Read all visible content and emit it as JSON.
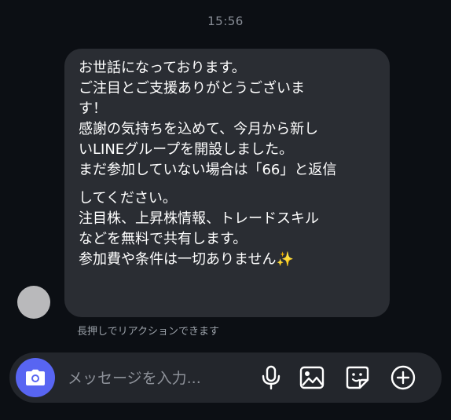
{
  "chat": {
    "timestamp": "15:56",
    "message": {
      "lines": [
        "お世話になっております。",
        "ご注目とご支援ありがとうございま",
        "す！",
        "感謝の気持ちを込めて、今月から新し",
        "いLINEグループを開設しました。",
        "まだ参加していない場合は「66」と返信",
        "してください。",
        "注目株、上昇株情報、トレードスキル",
        "などを無料で共有します。",
        "参加費や条件は一切ありません"
      ],
      "emoji": "✨"
    },
    "reaction_hint": "長押しでリアクションできます"
  },
  "composer": {
    "placeholder": "メッセージを入力...",
    "icons": [
      "camera-icon",
      "microphone-icon",
      "image-icon",
      "sticker-icon",
      "plus-icon"
    ],
    "camera_color": "#5865f2"
  }
}
